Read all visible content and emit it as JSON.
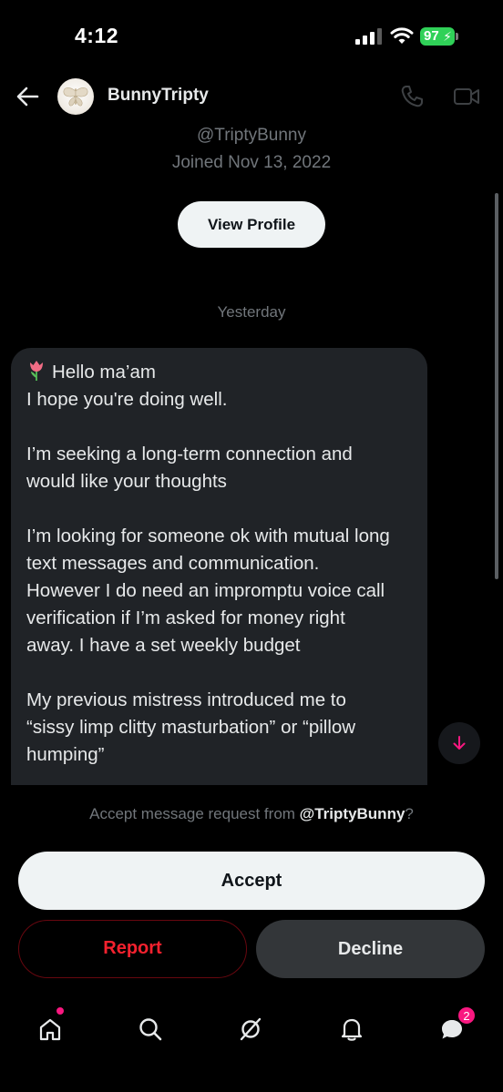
{
  "status_bar": {
    "time": "4:12",
    "battery": "97"
  },
  "header": {
    "name": "BunnyTripty"
  },
  "profile": {
    "handle": "@TriptyBunny",
    "joined": "Joined Nov 13, 2022",
    "view_profile_label": "View Profile"
  },
  "conversation": {
    "date_separator": "Yesterday",
    "message_lines": [
      "Hello ma’am",
      "I hope you're doing well.",
      "",
      "I’m seeking a long-term connection and",
      "would like your thoughts",
      "",
      "I’m looking for someone ok with mutual long",
      "text messages and communication.",
      "However I do need an impromptu voice call",
      "verification if I’m asked for money right",
      "away. I have a set weekly budget",
      "",
      "My previous mistress introduced me to",
      "“sissy limp clitty masturbation” or “pillow",
      "humping”"
    ]
  },
  "request": {
    "prompt_prefix": "Accept message request from ",
    "prompt_handle": "@TriptyBunny",
    "prompt_suffix": "?",
    "accept_label": "Accept",
    "report_label": "Report",
    "decline_label": "Decline"
  },
  "tabbar": {
    "items": [
      "home-icon",
      "search-icon",
      "grok-icon",
      "notifications-icon",
      "messages-icon"
    ],
    "messages_badge": "2"
  },
  "colors": {
    "background": "#000000",
    "bubble": "#202327",
    "muted_text": "#71767b",
    "danger": "#f4212e",
    "badge": "#f91880",
    "battery": "#30d158"
  }
}
